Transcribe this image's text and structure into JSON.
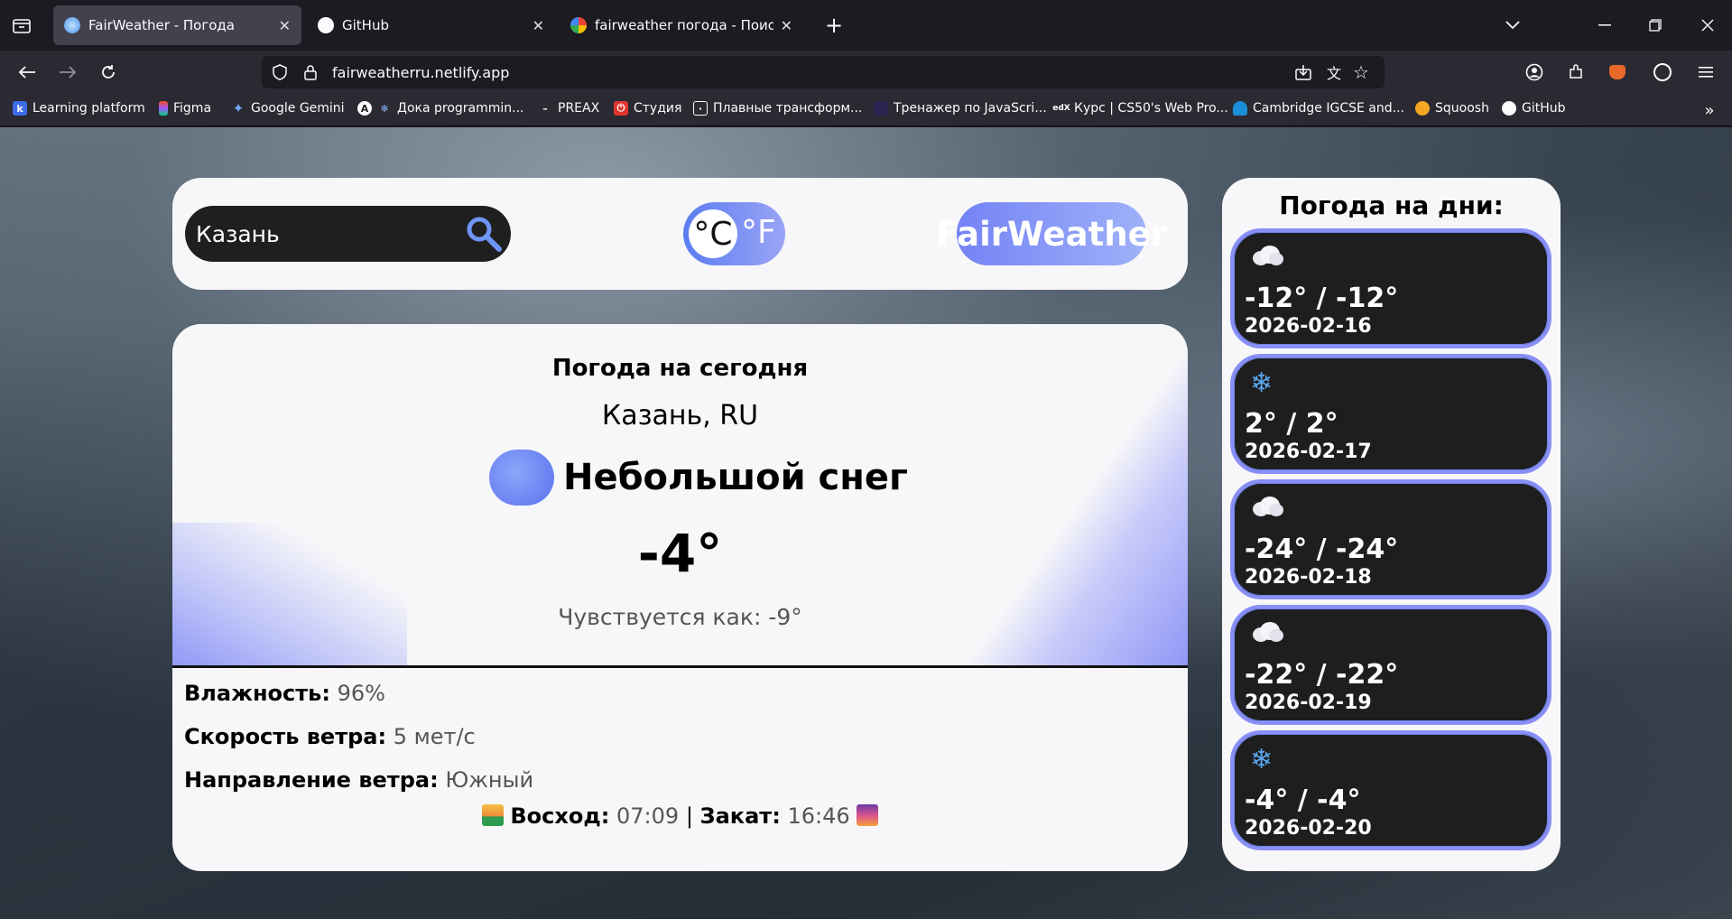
{
  "browser": {
    "tabs": [
      {
        "title": "FairWeather - Погода",
        "active": true
      },
      {
        "title": "GitHub",
        "active": false
      },
      {
        "title": "fairweather погода - Поиск в Google",
        "active": false
      }
    ],
    "url": "fairweatherru.netlify.app",
    "bookmarks": [
      "Learning platform",
      "Figma",
      "Google Gemini",
      "Дока programmin...",
      "PREAX",
      "Студия",
      "Плавные трансформ...",
      "Тренажер по JavaScri...",
      "Курс | CS50's Web Pro...",
      "Cambridge IGCSE and...",
      "Squoosh",
      "GitHub"
    ]
  },
  "header": {
    "search_value": "Казань",
    "unit_c": "°C",
    "unit_f": "°F",
    "brand": "FairWeather"
  },
  "today": {
    "title": "Погода на сегодня",
    "city": "Казань, RU",
    "condition": "Небольшой снег",
    "temp": "-4°",
    "feels": "Чувствуется как: -9°",
    "humidity_label": "Влажность:",
    "humidity_value": "96%",
    "wind_label": "Скорость ветра:",
    "wind_value": "5 мет/с",
    "wind_dir_label": "Направление ветра:",
    "wind_dir_value": "Южный",
    "sunrise_label": "Восход:",
    "sunrise_value": "07:09",
    "sep": "|",
    "sunset_label": "Закат:",
    "sunset_value": "16:46"
  },
  "forecast": {
    "title": "Погода на дни:",
    "days": [
      {
        "icon": "cloud-icon",
        "temp": "-12° / -12°",
        "date": "2026-02-16"
      },
      {
        "icon": "snowflake-icon",
        "temp": "2° / 2°",
        "date": "2026-02-17"
      },
      {
        "icon": "cloud-icon",
        "temp": "-24° / -24°",
        "date": "2026-02-18"
      },
      {
        "icon": "cloud-icon",
        "temp": "-22° / -22°",
        "date": "2026-02-19"
      },
      {
        "icon": "snowflake-icon",
        "temp": "-4° / -4°",
        "date": "2026-02-20"
      }
    ]
  },
  "colors": {
    "accent_start": "#5b7df2",
    "accent_end": "#9eb1f8",
    "card_bg": "#f7f7f9",
    "dark_pill": "#1e1e1e"
  }
}
